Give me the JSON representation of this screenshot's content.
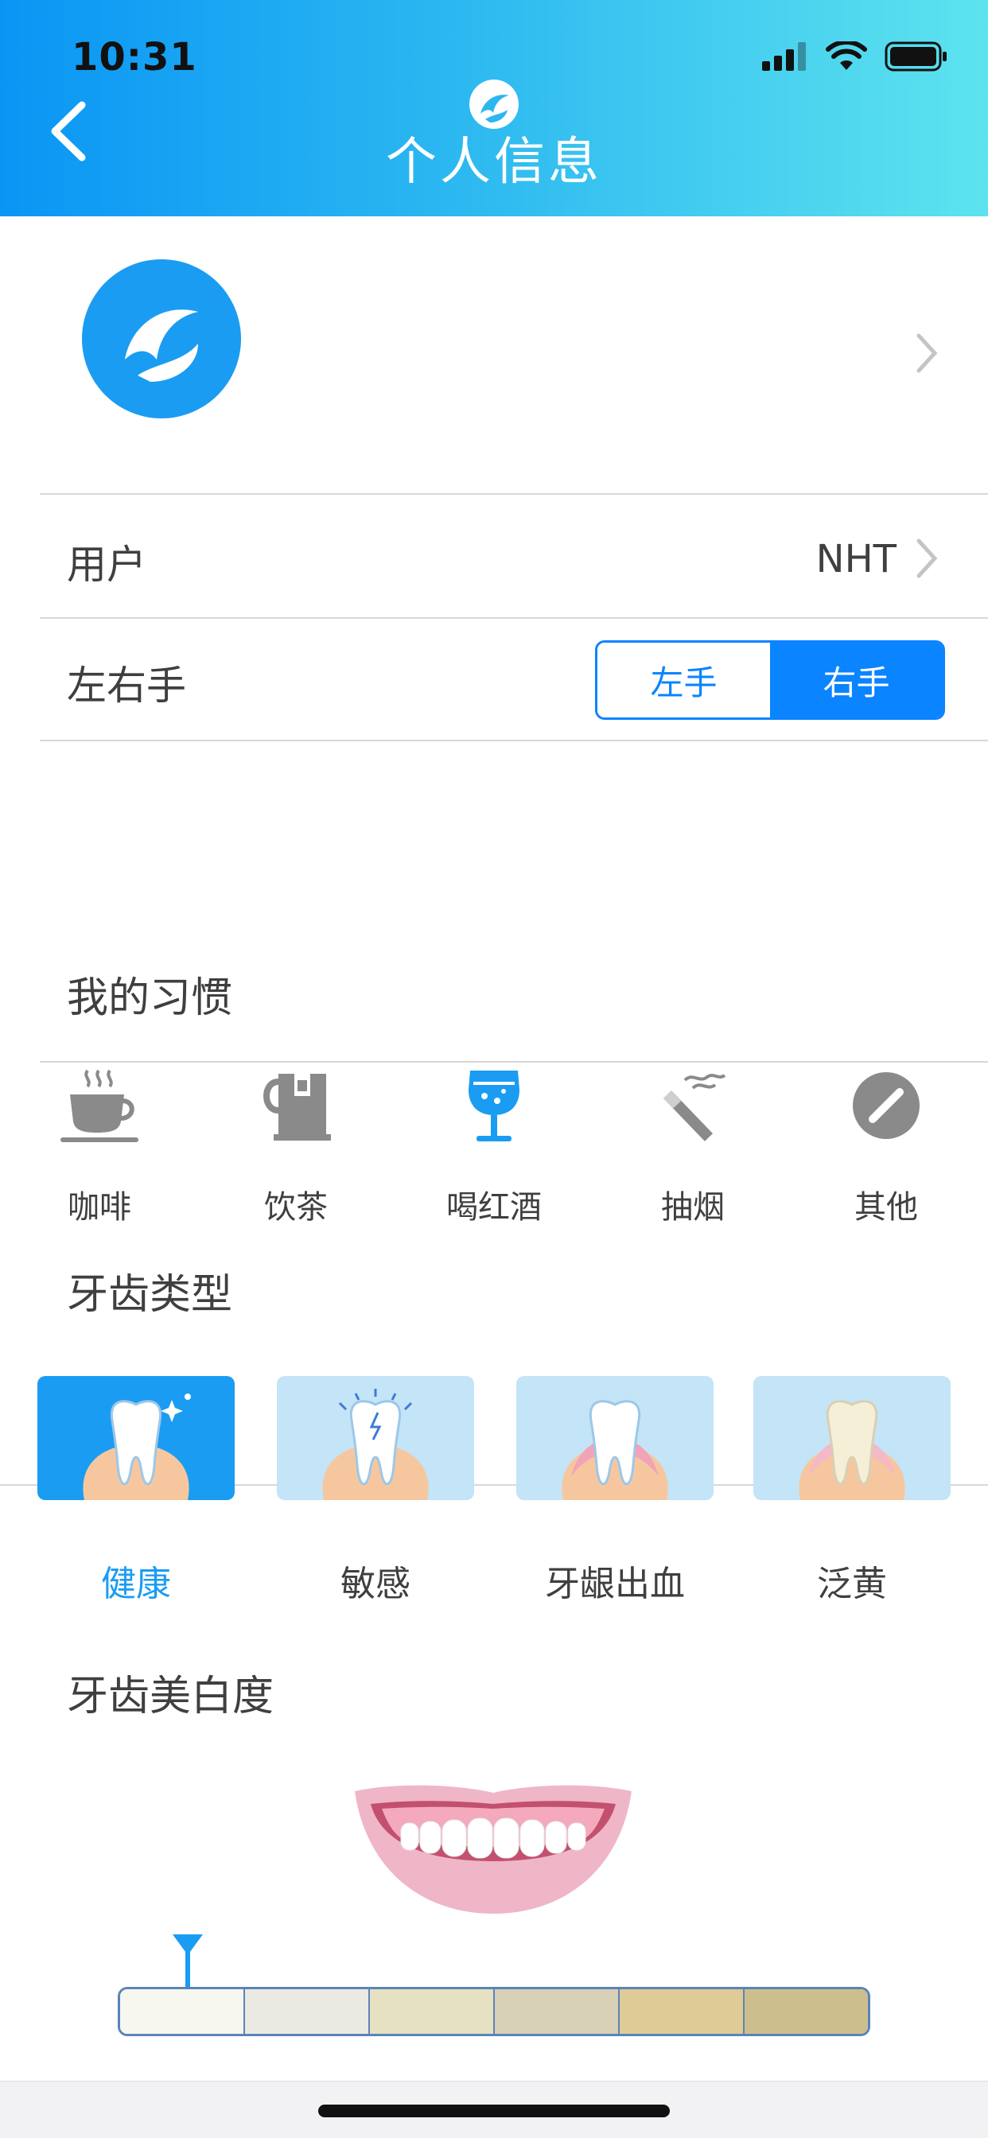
{
  "status": {
    "time": "10:31"
  },
  "header": {
    "title": "个人信息"
  },
  "profile": {
    "user_label": "用户",
    "user_value": "NHT",
    "hand_label": "左右手",
    "hand_options": [
      "左手",
      "右手"
    ],
    "hand_selected": "右手"
  },
  "habits": {
    "title": "我的习惯",
    "items": [
      {
        "label": "咖啡",
        "icon": "coffee-cup-icon",
        "selected": false
      },
      {
        "label": "饮茶",
        "icon": "tea-cup-icon",
        "selected": false
      },
      {
        "label": "喝红酒",
        "icon": "wine-glass-icon",
        "selected": true
      },
      {
        "label": "抽烟",
        "icon": "cigarette-icon",
        "selected": false
      },
      {
        "label": "其他",
        "icon": "other-icon",
        "selected": false
      }
    ]
  },
  "teeth_type": {
    "title": "牙齿类型",
    "items": [
      {
        "label": "健康",
        "icon": "healthy-tooth-icon",
        "selected": true
      },
      {
        "label": "敏感",
        "icon": "sensitive-tooth-icon",
        "selected": false
      },
      {
        "label": "牙龈出血",
        "icon": "bleeding-gum-tooth-icon",
        "selected": false
      },
      {
        "label": "泛黄",
        "icon": "yellow-tooth-icon",
        "selected": false
      }
    ]
  },
  "whiteness": {
    "title": "牙齿美白度",
    "shades": [
      "#f7f7f0",
      "#ebeae2",
      "#e6e1c3",
      "#d9d0b8",
      "#dfcb95",
      "#cdbf8d"
    ],
    "selected_index": 0
  },
  "colors": {
    "accent": "#1a9cf2",
    "segment_blue": "#0a84ff",
    "header_gradient_start": "#0a95f5",
    "header_gradient_end": "#5de3ef"
  }
}
